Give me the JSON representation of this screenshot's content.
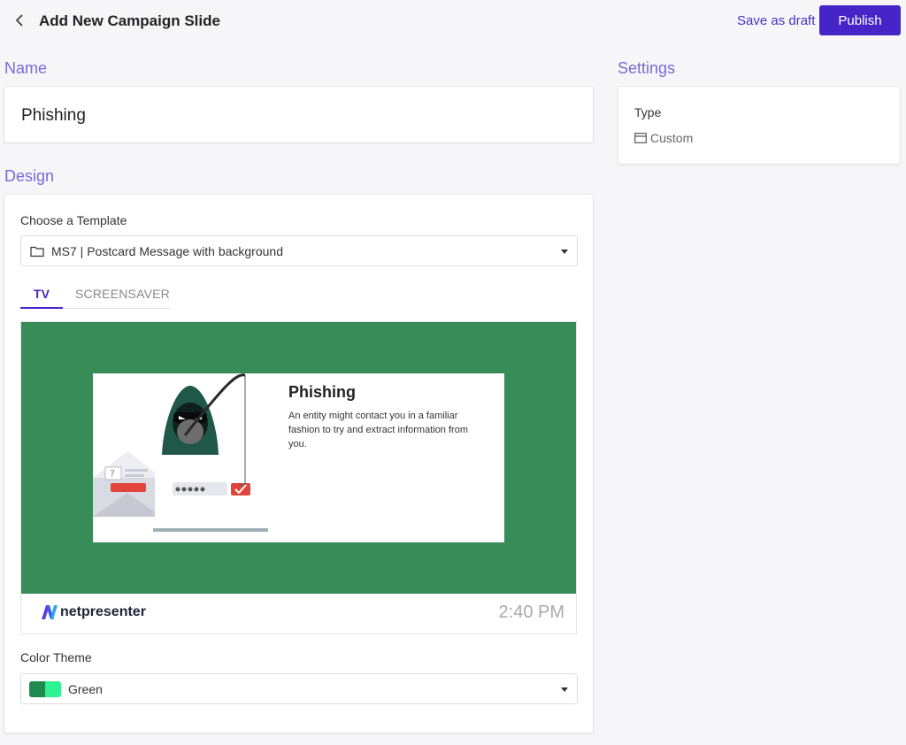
{
  "header": {
    "title": "Add New Campaign Slide",
    "save_draft_label": "Save as draft",
    "publish_label": "Publish"
  },
  "name_section": {
    "label": "Name",
    "value": "Phishing"
  },
  "settings_section": {
    "label": "Settings",
    "type_label": "Type",
    "type_value": "Custom"
  },
  "design_section": {
    "label": "Design",
    "template_label": "Choose a Template",
    "template_value": "MS7 | Postcard Message with background",
    "tabs": [
      {
        "label": "TV",
        "active": true
      },
      {
        "label": "SCREENSAVER",
        "active": false
      }
    ],
    "preview": {
      "background_color": "#388c57",
      "title": "Phishing",
      "body": "An entity might contact you in a familiar fashion to try and extract information from you.",
      "brand": "netpresenter",
      "time": "2:40 PM"
    },
    "color_theme_label": "Color Theme",
    "color_theme_value": "Green",
    "color_theme_swatch": [
      "#1e8a4f",
      "#2ff291"
    ]
  },
  "colors": {
    "accent": "#4525c8",
    "section_label": "#7a6ad6"
  },
  "icons": {
    "back": "chevron-left-icon",
    "type": "window-icon",
    "template": "folder-icon",
    "dropdown": "caret-down-icon",
    "brand": "netpresenter-logo"
  }
}
